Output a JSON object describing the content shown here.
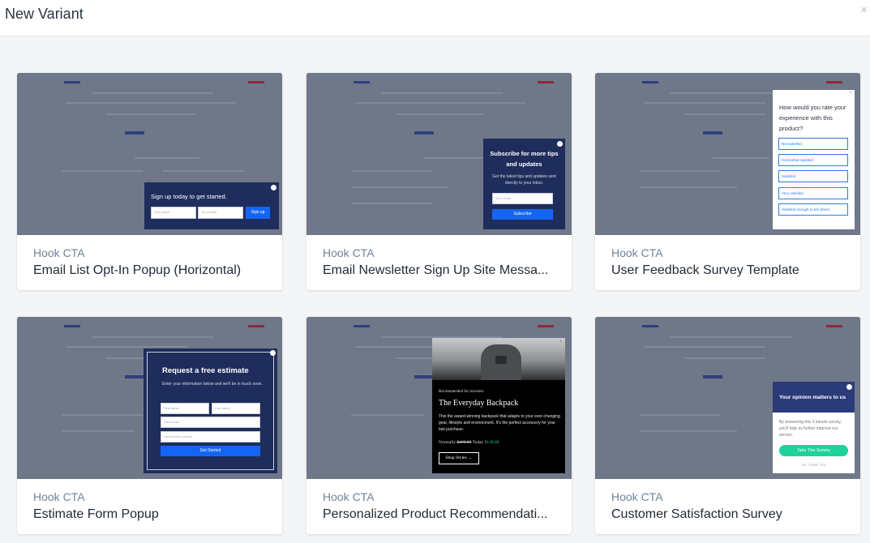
{
  "window": {
    "title": "New Variant",
    "close_glyph": "×"
  },
  "cards": [
    {
      "kind": "Hook CTA",
      "title": "Email List Opt-In Popup (Horizontal)",
      "preview": {
        "heading": "Sign up today to get started.",
        "first_name_placeholder": "First name",
        "email_placeholder": "Your email",
        "button": "Sign up"
      }
    },
    {
      "kind": "Hook CTA",
      "title": "Email Newsletter Sign Up Site Messa...",
      "preview": {
        "heading": "Subscribe for more tips and updates",
        "body": "Get the latest tips and updates sent directly to your inbox.",
        "email_placeholder": "Your email",
        "button": "Subscribe"
      }
    },
    {
      "kind": "Hook CTA",
      "title": "User Feedback Survey Template",
      "preview": {
        "question": "How would you rate your experience with this product?",
        "options": [
          "Not satisfied",
          "Somewhat satisfied",
          "Satisfied",
          "Very satisfied",
          "Satisfied enough to tell others"
        ]
      }
    },
    {
      "kind": "Hook CTA",
      "title": "Estimate Form Popup",
      "preview": {
        "heading": "Request a free estimate",
        "body": "Enter your information below and we'll be in touch soon.",
        "first_name_placeholder": "First name",
        "last_name_placeholder": "Last name",
        "email_placeholder": "Your email",
        "phone_placeholder": "Your phone number",
        "button": "Get Started"
      }
    },
    {
      "kind": "Hook CTA",
      "title": "Personalized Product Recommendati...",
      "preview": {
        "eyebrow": "Recommended for travelers",
        "heading": "The Everyday Backpack",
        "body": "This the award-winning backpack that adapts to your ever-changing gear, lifestyle and environment. It's the perfect accessory for your last purchase.",
        "price_label": "Normally",
        "old_price": "$299.99",
        "today_label": "Today",
        "new_price": "$149.00",
        "button": "Shop Styles →"
      }
    },
    {
      "kind": "Hook CTA",
      "title": "Customer Satisfaction Survey",
      "preview": {
        "heading": "Your opinion matters to us",
        "body": "By answering this 3 minute survey, you'll help us further improve our service.",
        "button": "Take The Survey",
        "decline": "No, Thank You"
      }
    }
  ],
  "colors": {
    "navy": "#1f2d5c",
    "blue": "#1565f5",
    "green": "#1fd19b",
    "card_kind": "#6e8398"
  }
}
